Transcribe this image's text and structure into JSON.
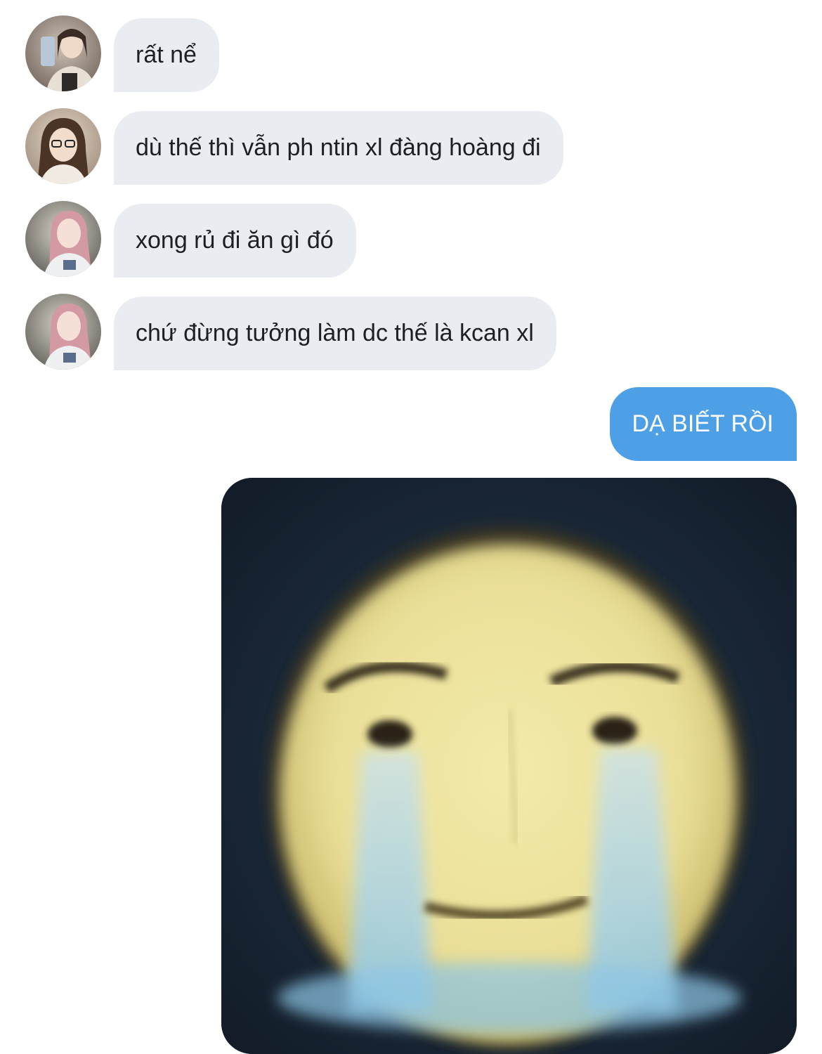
{
  "conversation": {
    "messages": [
      {
        "direction": "incoming",
        "text": "rất nể"
      },
      {
        "direction": "incoming",
        "text": "dù thế thì vẫn ph ntin xl đàng hoàng đi"
      },
      {
        "direction": "incoming",
        "text": "xong rủ đi ăn gì đó"
      },
      {
        "direction": "incoming",
        "text": "chứ đừng tưởng làm dc thế là kcan xl"
      },
      {
        "direction": "outgoing",
        "text": "DẠ BIẾT RỒI"
      },
      {
        "direction": "outgoing",
        "type": "image",
        "image_description_name": "crying-smiling-face-sticker"
      }
    ]
  },
  "colors": {
    "incoming_bubble": "#e9edf1",
    "outgoing_bubble": "#4d9fe6",
    "incoming_text": "#1d1f22",
    "outgoing_text": "#ffffff"
  },
  "icons": {
    "avatar": "user-avatar-photo"
  }
}
